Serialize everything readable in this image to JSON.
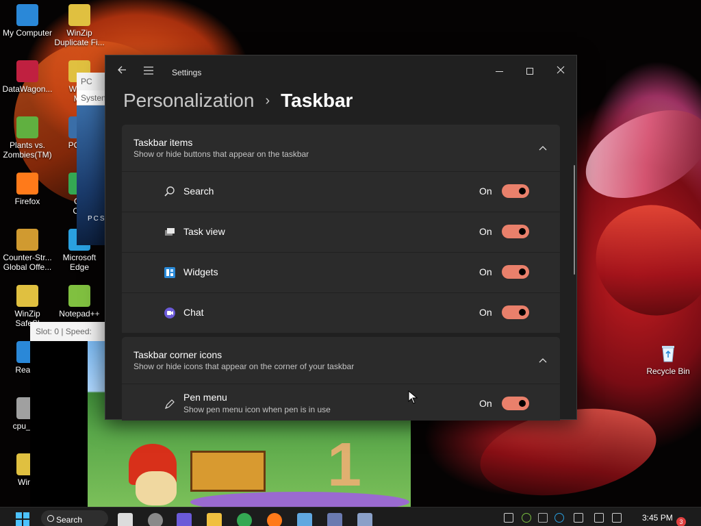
{
  "desktop": {
    "icons": [
      {
        "label": "My Computer",
        "icon": "monitor-icon",
        "color": "#2a88d8"
      },
      {
        "label": "WinZip\nDuplicate Fi...",
        "icon": "winzip-icon",
        "color": "#e0c040"
      },
      {
        "label": "DataWagon...",
        "icon": "datawagon-icon",
        "color": "#c02040"
      },
      {
        "label": "WinZi\nMa",
        "icon": "winzip-icon",
        "color": "#e0c040"
      },
      {
        "label": "Plants vs.\nZombies(TM)",
        "icon": "game-icon",
        "color": "#60b040"
      },
      {
        "label": "PCSX",
        "icon": "pcsx-icon",
        "color": "#3a6ea8"
      },
      {
        "label": "Firefox",
        "icon": "firefox-icon",
        "color": "#ff7a1a"
      },
      {
        "label": "Go\nChr",
        "icon": "chrome-icon",
        "color": "#34a853"
      },
      {
        "label": "Counter-Str...\nGlobal Offe...",
        "icon": "csgo-icon",
        "color": "#d09a30"
      },
      {
        "label": "Microsoft\nEdge",
        "icon": "edge-icon",
        "color": "#2aa0e0"
      },
      {
        "label": "WinZip\nSafeSl",
        "icon": "winzip-icon",
        "color": "#e0c040"
      },
      {
        "label": "Notepad++",
        "icon": "notepad-icon",
        "color": "#80c040"
      },
      {
        "label": "RealPl",
        "icon": "realplayer-icon",
        "color": "#2a88d8"
      },
      {
        "label": "cpu_eat",
        "icon": "gear-icon",
        "color": "#a0a0a0"
      },
      {
        "label": "WinZ",
        "icon": "winzip-icon",
        "color": "#e0c040"
      },
      {
        "label": "Recycle Bin",
        "icon": "recycle-bin-icon",
        "color": "#6ab0e0"
      }
    ]
  },
  "background_windows": {
    "pcsx": {
      "title": "PC",
      "system_label": "Systen",
      "art_text": "PCSX"
    },
    "emulator": {
      "status": "Slot: 0 | Speed:",
      "digit": "1"
    }
  },
  "settings": {
    "app_title": "Settings",
    "breadcrumb": {
      "parent": "Personalization",
      "separator": "›",
      "current": "Taskbar"
    },
    "sections": [
      {
        "title": "Taskbar items",
        "description": "Show or hide buttons that appear on the taskbar",
        "items": [
          {
            "label": "Search",
            "icon": "search-icon",
            "state": "On",
            "enabled": true
          },
          {
            "label": "Task view",
            "icon": "task-view-icon",
            "state": "On",
            "enabled": true
          },
          {
            "label": "Widgets",
            "icon": "widgets-icon",
            "state": "On",
            "enabled": true
          },
          {
            "label": "Chat",
            "icon": "chat-icon",
            "state": "On",
            "enabled": true
          }
        ]
      },
      {
        "title": "Taskbar corner icons",
        "description": "Show or hide icons that appear on the corner of your taskbar",
        "items": [
          {
            "label": "Pen menu",
            "sublabel": "Show pen menu icon when pen is in use",
            "icon": "pen-icon",
            "state": "On",
            "enabled": true
          }
        ]
      }
    ],
    "colors": {
      "toggle_on": "#e9806b",
      "card": "#2b2b2b",
      "window": "#202020"
    }
  },
  "taskbar": {
    "search_label": "Search",
    "clock": "3:45 PM",
    "notification_count": "3",
    "pinned": [
      "task-view-icon",
      "widgets-icon",
      "chat-icon",
      "file-explorer-icon",
      "chrome-icon",
      "firefox-icon",
      "notepad-icon",
      "pcsx-icon",
      "settings-icon"
    ],
    "tray": [
      "chevron-up-icon",
      "utorrent-icon",
      "network-app-icon",
      "edge-icon",
      "keyboard-icon",
      "display-icon",
      "volume-icon"
    ]
  }
}
